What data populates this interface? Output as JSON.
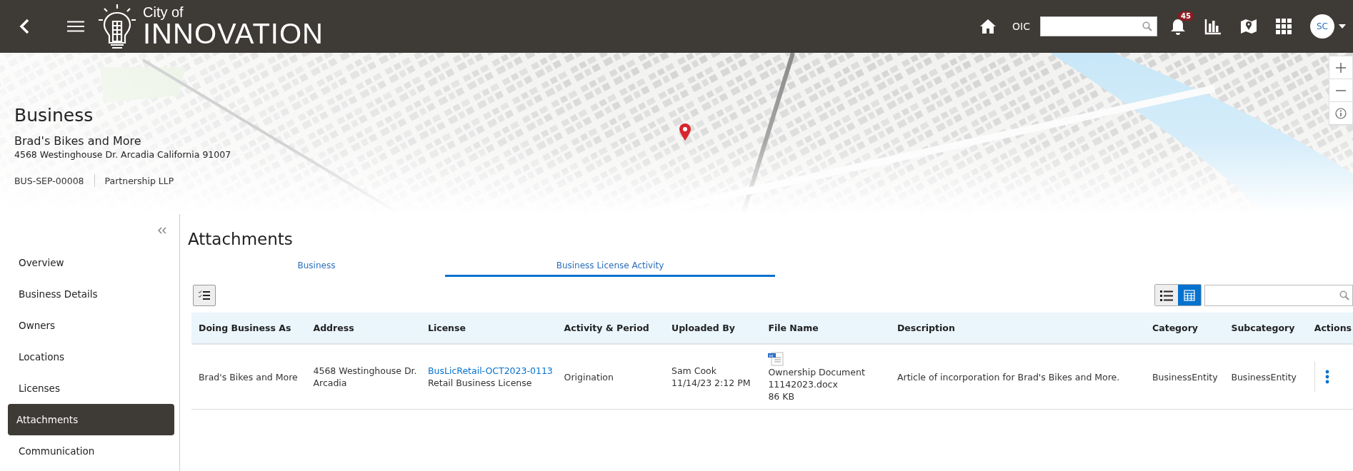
{
  "header": {
    "logo_small": "City of",
    "logo_large": "INNOVATION",
    "oic": "OIC",
    "notification_count": "45",
    "avatar": "SC"
  },
  "business": {
    "heading": "Business",
    "name": "Brad's Bikes and More",
    "address": "4568 Westinghouse Dr. Arcadia California 91007",
    "id": "BUS-SEP-00008",
    "type": "Partnership LLP"
  },
  "sidebar": {
    "items": [
      {
        "label": "Overview",
        "selected": false
      },
      {
        "label": "Business Details",
        "selected": false
      },
      {
        "label": "Owners",
        "selected": false
      },
      {
        "label": "Locations",
        "selected": false
      },
      {
        "label": "Licenses",
        "selected": false
      },
      {
        "label": "Attachments",
        "selected": true
      },
      {
        "label": "Communication",
        "selected": false
      }
    ]
  },
  "content": {
    "title": "Attachments",
    "tabs": [
      {
        "label": "Business",
        "selected": false
      },
      {
        "label": "Business License Activity",
        "selected": true
      }
    ],
    "view_toggle": [
      {
        "kind": "list",
        "selected": false
      },
      {
        "kind": "table",
        "selected": true
      }
    ],
    "table": {
      "columns": [
        "Doing Business As",
        "Address",
        "License",
        "Activity & Period",
        "Uploaded By",
        "File Name",
        "Description",
        "Category",
        "Subcategory",
        "Actions"
      ],
      "rows": [
        {
          "doing_business_as": "Brad's Bikes and More",
          "address": "4568 Westinghouse Dr. Arcadia",
          "license_link": "BusLicRetail-OCT2023-0113",
          "license_type": "Retail Business License",
          "activity": "Origination",
          "uploaded_by": "Sam Cook",
          "uploaded_at": "11/14/23 2:12 PM",
          "file_name": "Ownership Document 11142023.docx",
          "file_size": "86 KB",
          "description": "Article of incorporation for Brad's Bikes and More.",
          "category": "BusinessEntity",
          "subcategory": "BusinessEntity"
        }
      ]
    }
  }
}
